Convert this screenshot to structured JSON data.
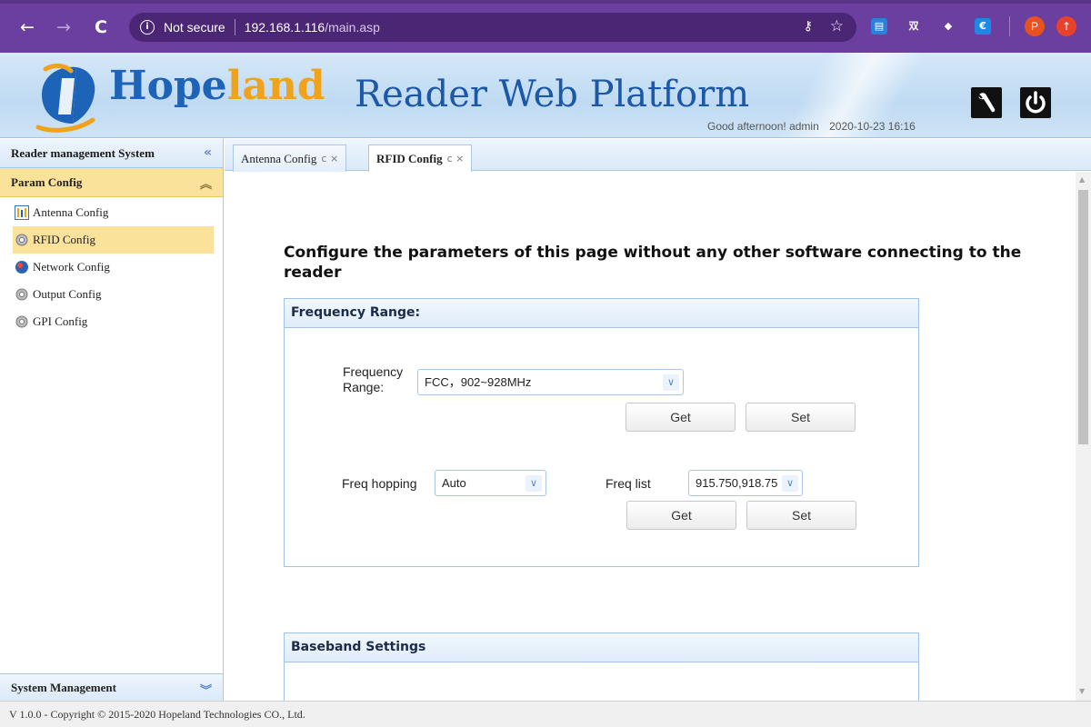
{
  "browser": {
    "security_label": "Not secure",
    "url_host": "192.168.1.116",
    "url_path": "/main.asp",
    "extensions": [
      "blue-extension",
      "translate-extension",
      "cube-extension",
      "euro-extension"
    ],
    "profile_initial": "P"
  },
  "header": {
    "logo_part1": "Hope",
    "logo_part2": "land",
    "platform_title": "Reader Web Platform",
    "greeting": "Good afternoon! admin",
    "datetime": "2020-10-23 16:16"
  },
  "sidebar": {
    "title": "Reader management System",
    "section": "Param Config",
    "items": [
      {
        "label": "Antenna Config",
        "icon": "antenna-icon"
      },
      {
        "label": "RFID Config",
        "icon": "gear-icon"
      },
      {
        "label": "Network Config",
        "icon": "network-icon"
      },
      {
        "label": "Output Config",
        "icon": "gear-icon"
      },
      {
        "label": "GPI Config",
        "icon": "gear-icon"
      }
    ],
    "bottom_section": "System Management"
  },
  "tabs": [
    {
      "label": "Antenna Config",
      "controls": "c ×"
    },
    {
      "label": "RFID Config",
      "controls": "c ×"
    }
  ],
  "main": {
    "heading": "Configure the parameters of this page without any other software connecting to the reader",
    "freq_panel": {
      "title": "Frequency Range:",
      "range_label": "Frequency Range:",
      "range_value": "FCC，902~928MHz",
      "get_label": "Get",
      "set_label": "Set",
      "hopping_label": "Freq hopping",
      "hopping_value": "Auto",
      "list_label": "Freq list",
      "list_value": "915.750,918.75"
    },
    "baseband_panel": {
      "title": "Baseband Settings"
    }
  },
  "footer": {
    "text": "V 1.0.0 - Copyright © 2015-2020 Hopeland Technologies CO., Ltd."
  },
  "colors": {
    "browser_chrome": "#6b3fa0",
    "active_highlight": "#fbe29a",
    "brand_blue": "#1d63b8",
    "brand_orange": "#f0a21b"
  }
}
